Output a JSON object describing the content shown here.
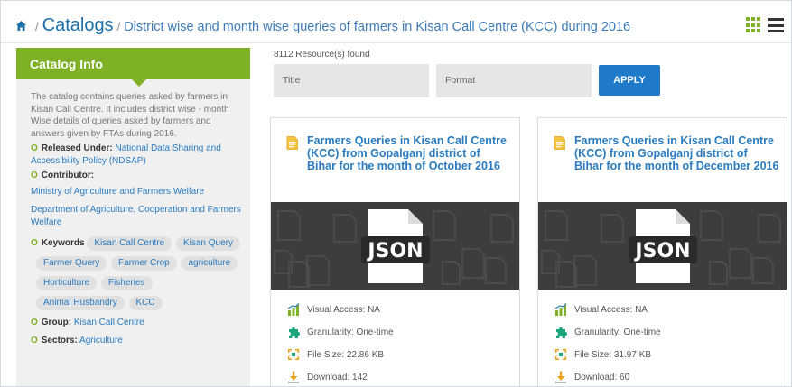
{
  "breadcrumb": {
    "separator": "/",
    "catalogs": "Catalogs",
    "title": "District wise and month wise queries of farmers in Kisan Call Centre (KCC) during 2016"
  },
  "sidebar": {
    "heading": "Catalog Info",
    "description": "The catalog contains queries asked by farmers in Kisan Call Centre. It includes district wise - month Wise details of queries asked by farmers and answers given by FTAs during 2016.",
    "bullet": "O",
    "released_label": "Released Under:",
    "released_value": "National Data Sharing and Accessibility Policy (NDSAP)",
    "contributor_label": "Contributor:",
    "contributors": [
      "Ministry of Agriculture and Farmers Welfare",
      "Department of Agriculture, Cooperation and Farmers Welfare"
    ],
    "keywords_label": "Keywords",
    "keywords": [
      "Kisan Call Centre",
      "Kisan Query",
      "Farmer Query",
      "Farmer Crop",
      "agriculture",
      "Horticulture",
      "Fisheries",
      "Animal Husbandry",
      "KCC"
    ],
    "group_label": "Group:",
    "group_value": "Kisan Call Centre",
    "sectors_label": "Sectors:",
    "sectors_value": "Agriculture"
  },
  "results": {
    "count_text": "8112 Resource(s) found",
    "filter_title": "Title",
    "filter_format": "Format",
    "apply_label": "APPLY"
  },
  "cards": [
    {
      "title": "Farmers Queries in Kisan Call Centre (KCC) from Gopalganj district of Bihar for the month of October 2016",
      "format": "JSON",
      "visual_access": "Visual Access: NA",
      "granularity": "Granularity: One-time",
      "file_size": "File Size: 22.86 KB",
      "download": "Download: 142"
    },
    {
      "title": "Farmers Queries in Kisan Call Centre (KCC) from Gopalganj district of Bihar for the month of December 2016",
      "format": "JSON",
      "visual_access": "Visual Access: NA",
      "granularity": "Granularity: One-time",
      "file_size": "File Size: 31.97 KB",
      "download": "Download: 60"
    }
  ],
  "colors": {
    "accent_green": "#7fb127",
    "link_blue": "#2a7bbf",
    "button_blue": "#1f7ac9",
    "thumb_dark": "#3d3d3d"
  },
  "icons": [
    "home-icon",
    "grid-view-icon",
    "list-view-icon",
    "document-icon",
    "json-file-icon",
    "chart-icon",
    "puzzle-icon",
    "expand-icon",
    "download-icon"
  ]
}
